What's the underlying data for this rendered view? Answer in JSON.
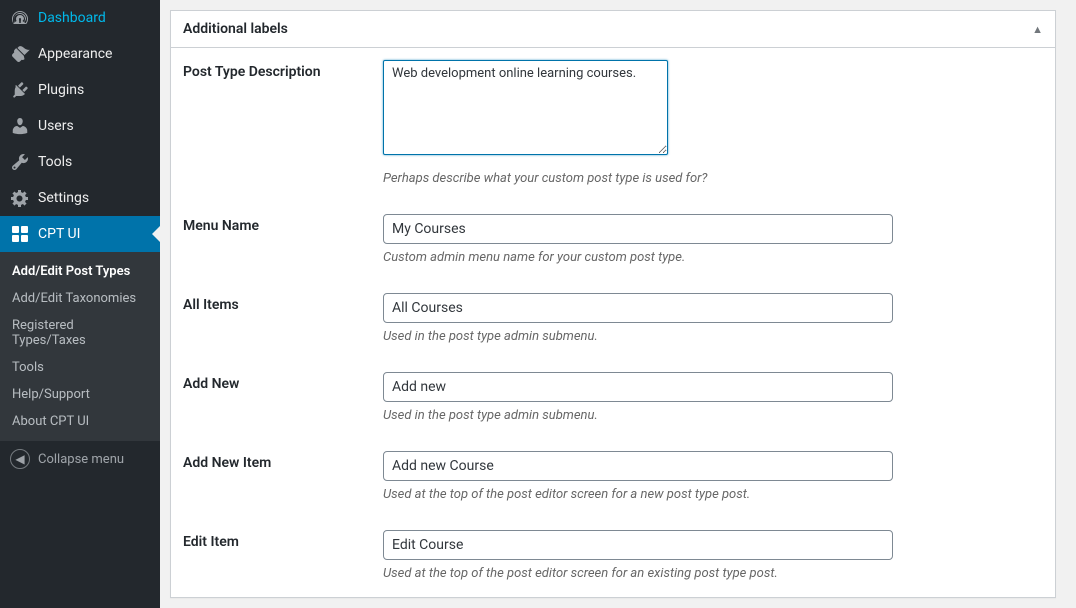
{
  "sidebar": {
    "items": [
      {
        "label": "Dashboard",
        "icon": "dashboard"
      },
      {
        "label": "Appearance",
        "icon": "appearance"
      },
      {
        "label": "Plugins",
        "icon": "plugins"
      },
      {
        "label": "Users",
        "icon": "users"
      },
      {
        "label": "Tools",
        "icon": "tools"
      },
      {
        "label": "Settings",
        "icon": "settings"
      },
      {
        "label": "CPT UI",
        "icon": "cptui",
        "active": true
      }
    ],
    "submenu": [
      {
        "label": "Add/Edit Post Types",
        "current": true
      },
      {
        "label": "Add/Edit Taxonomies"
      },
      {
        "label": "Registered Types/Taxes"
      },
      {
        "label": "Tools"
      },
      {
        "label": "Help/Support"
      },
      {
        "label": "About CPT UI"
      }
    ],
    "collapse_label": "Collapse menu"
  },
  "panel": {
    "title": "Additional labels"
  },
  "fields": {
    "description": {
      "label": "Post Type Description",
      "value": "Web development online learning courses.",
      "help": "Perhaps describe what your custom post type is used for?"
    },
    "menu_name": {
      "label": "Menu Name",
      "value": "My Courses",
      "help": "Custom admin menu name for your custom post type."
    },
    "all_items": {
      "label": "All Items",
      "value": "All Courses",
      "help": "Used in the post type admin submenu."
    },
    "add_new": {
      "label": "Add New",
      "value": "Add new",
      "help": "Used in the post type admin submenu."
    },
    "add_new_item": {
      "label": "Add New Item",
      "value": "Add new Course",
      "help": "Used at the top of the post editor screen for a new post type post."
    },
    "edit_item": {
      "label": "Edit Item",
      "value": "Edit Course",
      "help": "Used at the top of the post editor screen for an existing post type post."
    }
  }
}
